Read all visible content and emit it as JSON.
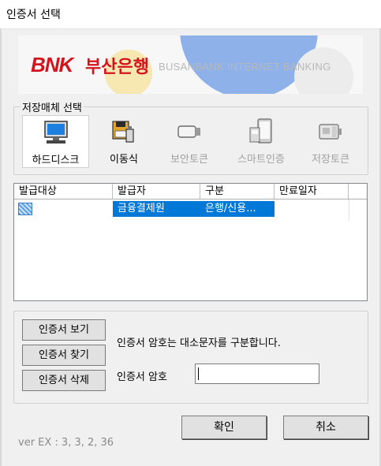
{
  "window": {
    "title": "인증서 선택"
  },
  "banner": {
    "logo_en": "BNK",
    "logo_ko": "부산은행",
    "tagline": "BUSANBANK INTERNET BANKING"
  },
  "storage": {
    "legend": "저장매체 선택",
    "items": [
      {
        "label": "하드디스크",
        "icon": "monitor-icon",
        "state": "selected"
      },
      {
        "label": "이동식",
        "icon": "floppy-usb-icon",
        "state": "enabled"
      },
      {
        "label": "보안토큰",
        "icon": "usb-token-icon",
        "state": "disabled"
      },
      {
        "label": "스마트인증",
        "icon": "smartphone-icon",
        "state": "disabled"
      },
      {
        "label": "저장토큰",
        "icon": "storage-token-icon",
        "state": "disabled"
      }
    ]
  },
  "cert_list": {
    "columns": [
      "발급대상",
      "발급자",
      "구분",
      "만료일자"
    ],
    "rows": [
      {
        "subject": "",
        "issuer": "금융결제원",
        "type": "은행/신용...",
        "expiry": ""
      }
    ]
  },
  "actions": {
    "view_button": "인증서 보기",
    "find_button": "인증서 찾기",
    "delete_button": "인증서 삭제",
    "notice": "인증서 암호는 대소문자를 구분합니다.",
    "password_label": "인증서 암호",
    "password_value": ""
  },
  "footer": {
    "ok_button": "확인",
    "cancel_button": "취소",
    "version": "ver EX : 3, 3, 2, 36"
  },
  "colors": {
    "accent": "#0078d7",
    "brand": "#d4141c"
  }
}
